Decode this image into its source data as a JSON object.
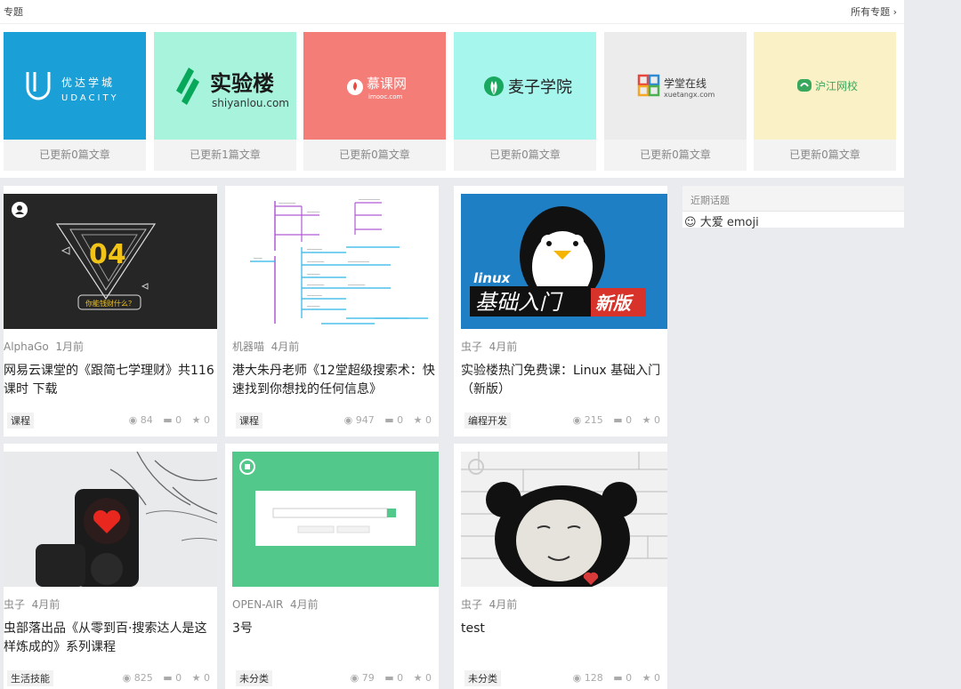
{
  "topics": {
    "title": "专题",
    "all_label": "所有专题",
    "items": [
      {
        "brand_cn": "优达学城",
        "brand_en": "UDACITY",
        "count": "已更新0篇文章",
        "bg": "#1a9fd6"
      },
      {
        "brand_cn": "实验楼",
        "brand_en": "shiyanlou.com",
        "count": "已更新1篇文章",
        "bg": "#a8f3dc"
      },
      {
        "brand_cn": "慕课网",
        "brand_en": "imooc.com",
        "count": "已更新0篇文章",
        "bg": "#f57d78"
      },
      {
        "brand_cn": "麦子学院",
        "brand_en": "",
        "count": "已更新0篇文章",
        "bg": "#a6f6ee"
      },
      {
        "brand_cn": "学堂在线",
        "brand_en": "xuetangx.com",
        "count": "已更新0篇文章",
        "bg": "#ececec"
      },
      {
        "brand_cn": "沪江网校",
        "brand_en": "",
        "count": "已更新0篇文章",
        "bg": "#fbf1c6"
      }
    ]
  },
  "posts": [
    {
      "author": "AlphaGo",
      "time": "1月前",
      "title": "网易云课堂的《跟简七学理财》共116课时 下载",
      "tag": "课程",
      "views": "84",
      "comments": "0",
      "likes": "0",
      "img_text": "04",
      "img_caption": "你能钱财什么？"
    },
    {
      "author": "机器喵",
      "time": "4月前",
      "title": "港大朱丹老师《12堂超级搜索术：快速找到你想找的任何信息》",
      "tag": "课程",
      "views": "947",
      "comments": "0",
      "likes": "0"
    },
    {
      "author": "虫子",
      "time": "4月前",
      "title": "实验楼热门免费课：Linux 基础入门（新版）",
      "tag": "编程开发",
      "views": "215",
      "comments": "0",
      "likes": "0",
      "img_text": "基础入门",
      "img_word": "linux",
      "img_badge": "新版"
    },
    {
      "author": "虫子",
      "time": "4月前",
      "title": "虫部落出品《从零到百·搜索达人是这样炼成的》系列课程",
      "tag": "生活技能",
      "views": "825",
      "comments": "0",
      "likes": "0"
    },
    {
      "author": "OPEN-AIR",
      "time": "4月前",
      "title": "3号",
      "tag": "未分类",
      "views": "79",
      "comments": "0",
      "likes": "0"
    },
    {
      "author": "虫子",
      "time": "4月前",
      "title": "test",
      "tag": "未分类",
      "views": "128",
      "comments": "0",
      "likes": "0"
    }
  ],
  "sidebar": {
    "title": "近期话题",
    "items": [
      {
        "label": "大爱 emoji"
      }
    ]
  }
}
